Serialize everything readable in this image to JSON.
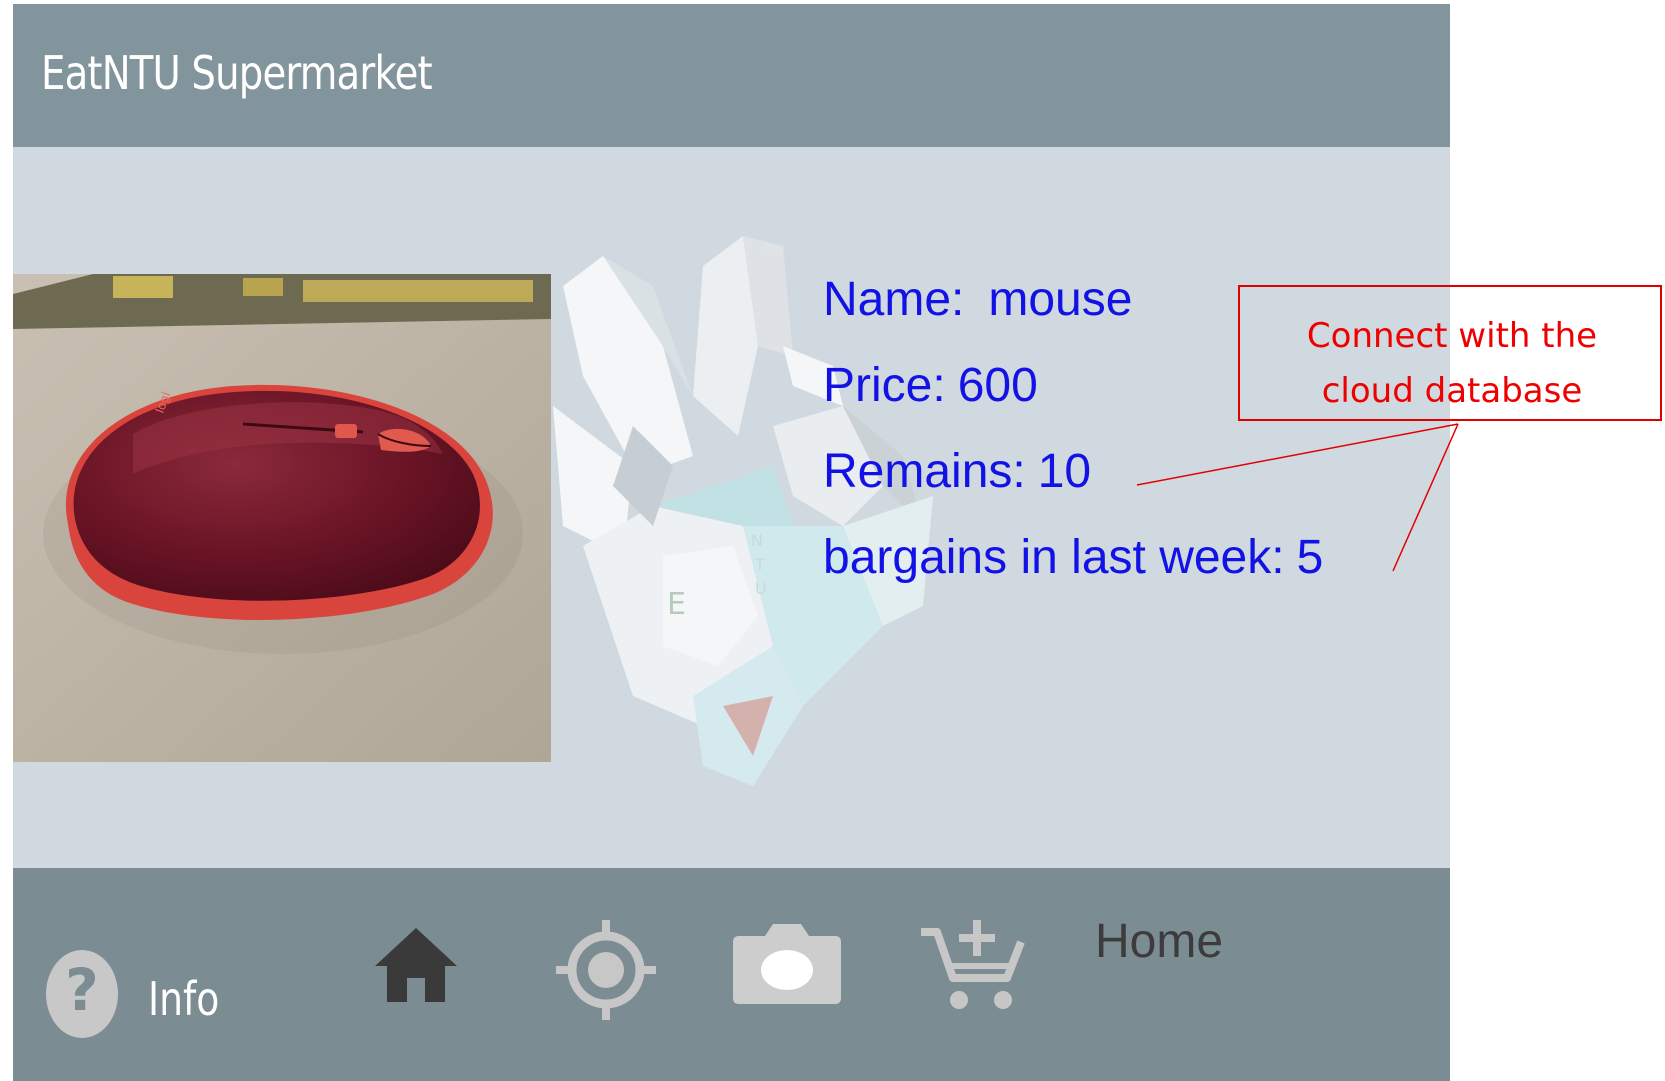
{
  "app": {
    "title": "EatNTU Supermarket"
  },
  "product": {
    "name_label": "Name:",
    "name_value": "mouse",
    "price_label": "Price:",
    "price_value": "600",
    "remains_label": "Remains:",
    "remains_value": "10",
    "bargains_label": "bargains in last week:",
    "bargains_value": "5",
    "text_color": "#1212e6"
  },
  "bottom_nav": {
    "info_label": "Info",
    "help_glyph": "?",
    "icons": [
      "home-icon",
      "locate-icon",
      "camera-icon",
      "add-to-cart-icon"
    ],
    "current_page_label": "Home"
  },
  "annotation": {
    "text_line1": "Connect with the",
    "text_line2": "cloud database",
    "color": "#ee0000"
  },
  "colors": {
    "header_bg": "#82959c",
    "content_bg": "#d0d9df",
    "nav_bg": "#7b8c92"
  }
}
